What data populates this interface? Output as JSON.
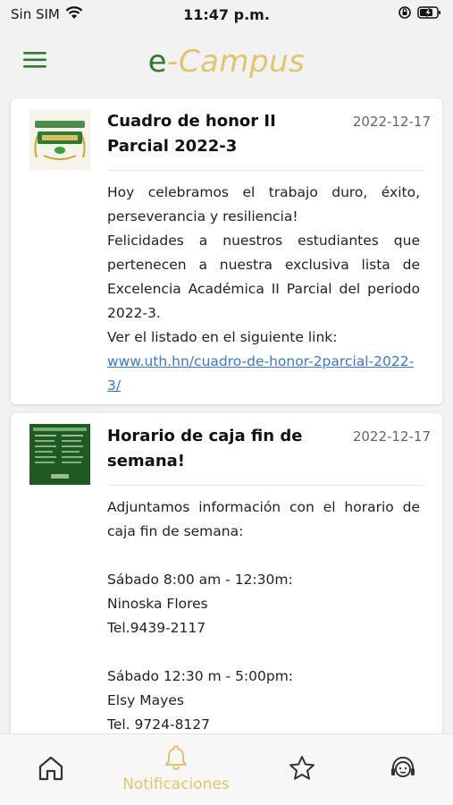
{
  "status_bar": {
    "carrier": "Sin SIM",
    "time": "11:47 p.m."
  },
  "header": {
    "title_e": "e",
    "title_rest": "-Campus",
    "brand_green": "#2f7a2f",
    "brand_gold": "#e1c46d"
  },
  "posts": [
    {
      "title": "Cuadro de honor II Parcial 2022-3",
      "date": "2022-12-17",
      "thumb_icon": "honor-roll-thumbnail",
      "body": [
        "Hoy celebramos el trabajo duro, éxito, perseverancia y resiliencia!",
        "Felicidades a nuestros estudiantes que pertenecen a nuestra exclusiva lista de Excelencia Académica II Parcial del periodo 2022-3.",
        "Ver el listado en el siguiente link:"
      ],
      "link": "www.uth.hn/cuadro-de-honor-2parcial-2022-3/"
    },
    {
      "title": "Horario de caja fin de semana!",
      "date": "2022-12-17",
      "thumb_icon": "schedule-poster-thumbnail",
      "body": [
        "Adjuntamos información con el horario de caja fin de semana:",
        "",
        "Sábado 8:00 am - 12:30m:",
        "Ninoska Flores",
        "Tel.9439-2117",
        "",
        "Sábado 12:30 m - 5:00pm:",
        "Elsy Mayes",
        "Tel. 9724-8127"
      ]
    }
  ],
  "tab_bar": {
    "active_label": "Notificaciones",
    "active_color": "#e1c46d",
    "tabs": [
      "home-icon",
      "bell-icon",
      "star-icon",
      "support-icon"
    ]
  }
}
